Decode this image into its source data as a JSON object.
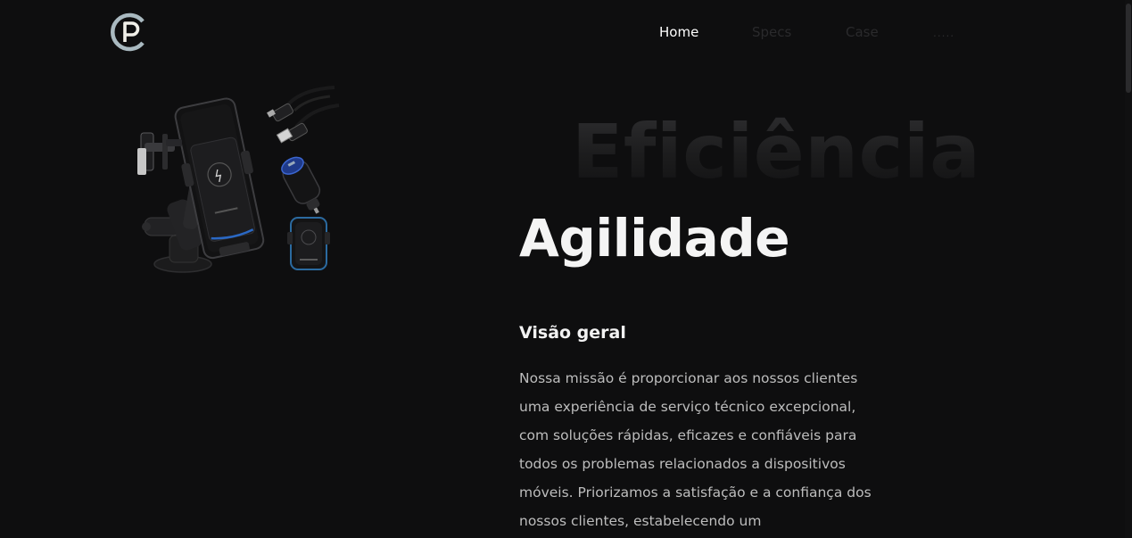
{
  "header": {
    "nav": {
      "home": "Home",
      "specs": "Specs",
      "case": "Case",
      "more": "....."
    }
  },
  "hero": {
    "background_word": "Eficiência",
    "headline": "Agilidade",
    "overview_title": "Visão geral",
    "overview_text": "Nossa missão é proporcionar aos nossos clientes uma experiência de serviço técnico excepcional, com soluções rápidas, eficazes e confiáveis para todos os problemas relacionados a dispositivos móveis. Priorizamos a satisfação e a confiança dos nossos clientes, estabelecendo um"
  },
  "colors": {
    "background": "#0e0e0f",
    "logo_ring": "#a9b9c0",
    "logo_letter": "#f0efe8",
    "nav_active": "#ffffff",
    "nav_inactive": "#2a2a2c",
    "body_text": "#bdbdbd"
  },
  "icons": {
    "logo": "cp-monogram-logo",
    "product_image": "car-phone-holder-accessories-image"
  }
}
